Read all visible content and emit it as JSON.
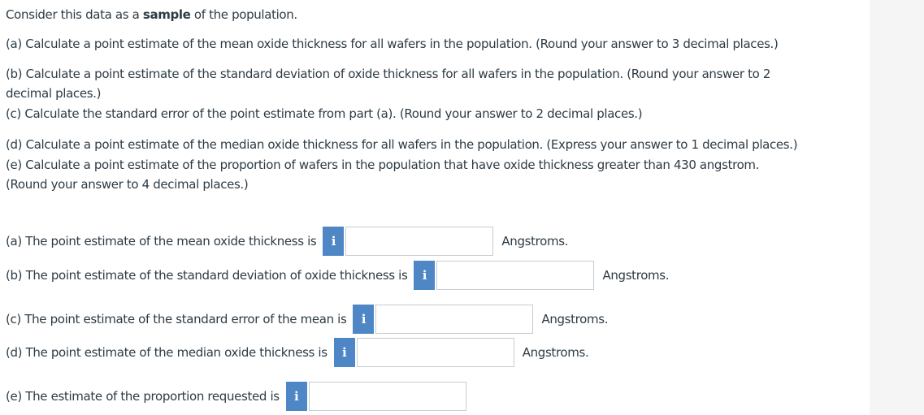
{
  "intro": {
    "prefix": "Consider this data as a ",
    "bold": "sample",
    "suffix": " of the population."
  },
  "questions": {
    "a": "(a) Calculate a point estimate of the mean oxide thickness for all wafers in the population. (Round your answer to 3 decimal places.)",
    "b_line1": "(b) Calculate a point estimate of the standard deviation of oxide thickness for all wafers in the population. (Round your answer to 2",
    "b_line2": "decimal places.)",
    "c": "(c) Calculate the standard error of the point estimate from part (a). (Round your answer to 2 decimal places.)",
    "d": "(d) Calculate a point estimate of the median oxide thickness for all wafers in the population. (Express your answer to 1 decimal places.)",
    "e_line1": "(e) Calculate a point estimate of the proportion of wafers in the population that have oxide thickness greater than 430 angstrom.",
    "e_line2": "(Round your answer to 4 decimal places.)"
  },
  "answers": {
    "a": {
      "label": "(a) The point estimate of the mean oxide thickness is",
      "value": "",
      "unit": "Angstroms."
    },
    "b": {
      "label": "(b) The point estimate of the standard deviation of oxide thickness is",
      "value": "",
      "unit": "Angstroms."
    },
    "c": {
      "label": "(c) The point estimate of the standard error of the mean is",
      "value": "",
      "unit": "Angstroms."
    },
    "d": {
      "label": "(d) The point estimate of the median oxide thickness is",
      "value": "",
      "unit": "Angstroms."
    },
    "e": {
      "label": "(e) The estimate of the proportion requested is",
      "value": ""
    }
  },
  "info_icon": {
    "glyph": "i",
    "name": "info-icon"
  },
  "colors": {
    "text": "#2d3b45",
    "info_button": "#4f86c6",
    "input_border": "#c7cdd1",
    "side_panel": "#f5f5f5"
  }
}
